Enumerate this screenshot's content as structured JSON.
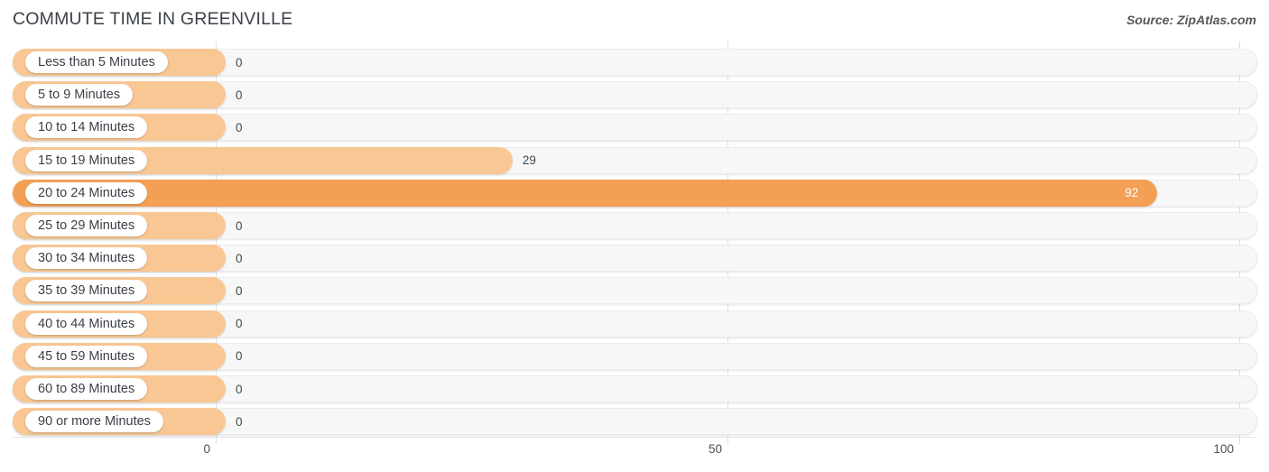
{
  "header": {
    "title": "COMMUTE TIME IN GREENVILLE",
    "source": "Source: ZipAtlas.com"
  },
  "colors": {
    "bar_light": "#f9c793",
    "bar_dark": "#f3a055",
    "track": "#f7f7f7",
    "gridline": "#e0e0e0",
    "text": "#3c4148"
  },
  "chart_data": {
    "type": "bar",
    "orientation": "horizontal",
    "title": "COMMUTE TIME IN GREENVILLE",
    "xlabel": "",
    "ylabel": "",
    "xlim": [
      0,
      100
    ],
    "grid": true,
    "legend": "none",
    "source": "Source: ZipAtlas.com",
    "axis_ticks": [
      "0",
      "50",
      "100"
    ],
    "axis_tick_values": [
      0,
      50,
      100
    ],
    "categories": [
      "Less than 5 Minutes",
      "5 to 9 Minutes",
      "10 to 14 Minutes",
      "15 to 19 Minutes",
      "20 to 24 Minutes",
      "25 to 29 Minutes",
      "30 to 34 Minutes",
      "35 to 39 Minutes",
      "40 to 44 Minutes",
      "45 to 59 Minutes",
      "60 to 89 Minutes",
      "90 or more Minutes"
    ],
    "values": [
      0,
      0,
      0,
      29,
      92,
      0,
      0,
      0,
      0,
      0,
      0,
      0
    ],
    "value_labels": [
      "0",
      "0",
      "0",
      "29",
      "92",
      "0",
      "0",
      "0",
      "0",
      "0",
      "0",
      "0"
    ]
  },
  "rows": [
    {
      "label": "Less than 5 Minutes",
      "value": 0,
      "value_label": "0",
      "shade": "light",
      "label_inside": false
    },
    {
      "label": "5 to 9 Minutes",
      "value": 0,
      "value_label": "0",
      "shade": "light",
      "label_inside": false
    },
    {
      "label": "10 to 14 Minutes",
      "value": 0,
      "value_label": "0",
      "shade": "light",
      "label_inside": false
    },
    {
      "label": "15 to 19 Minutes",
      "value": 29,
      "value_label": "29",
      "shade": "light",
      "label_inside": false
    },
    {
      "label": "20 to 24 Minutes",
      "value": 92,
      "value_label": "92",
      "shade": "dark",
      "label_inside": true
    },
    {
      "label": "25 to 29 Minutes",
      "value": 0,
      "value_label": "0",
      "shade": "light",
      "label_inside": false
    },
    {
      "label": "30 to 34 Minutes",
      "value": 0,
      "value_label": "0",
      "shade": "light",
      "label_inside": false
    },
    {
      "label": "35 to 39 Minutes",
      "value": 0,
      "value_label": "0",
      "shade": "light",
      "label_inside": false
    },
    {
      "label": "40 to 44 Minutes",
      "value": 0,
      "value_label": "0",
      "shade": "light",
      "label_inside": false
    },
    {
      "label": "45 to 59 Minutes",
      "value": 0,
      "value_label": "0",
      "shade": "light",
      "label_inside": false
    },
    {
      "label": "60 to 89 Minutes",
      "value": 0,
      "value_label": "0",
      "shade": "light",
      "label_inside": false
    },
    {
      "label": "90 or more Minutes",
      "value": 0,
      "value_label": "0",
      "shade": "light",
      "label_inside": false
    }
  ],
  "axis": {
    "ticks": [
      {
        "label": "0",
        "value": 0
      },
      {
        "label": "50",
        "value": 50
      },
      {
        "label": "100",
        "value": 100
      }
    ]
  }
}
